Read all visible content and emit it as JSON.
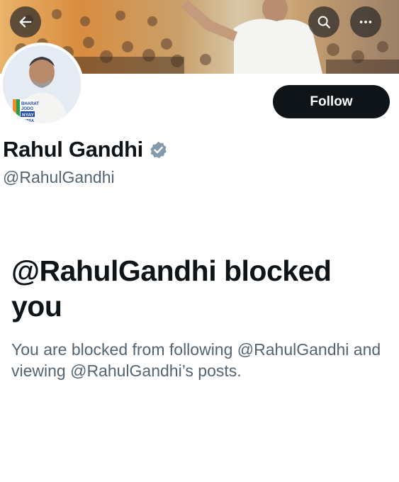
{
  "profile": {
    "display_name": "Rahul Gandhi",
    "handle": "@RahulGandhi",
    "verified": true,
    "avatar_badge_lines": [
      "BHARAT",
      "JODO",
      "NYAY",
      "YATRA"
    ]
  },
  "header": {
    "back_icon": "arrow-left-icon",
    "search_icon": "search-icon",
    "more_icon": "more-horizontal-icon"
  },
  "actions": {
    "follow_label": "Follow"
  },
  "blocked": {
    "title": "@RahulGandhi blocked you",
    "description": "You are blocked from following @RahulGandhi and viewing @RahulGandhi’s posts."
  },
  "colors": {
    "primary_text": "#0f1419",
    "secondary_text": "#536471",
    "follow_bg": "#0f1419",
    "verified_badge": "#829aab"
  }
}
